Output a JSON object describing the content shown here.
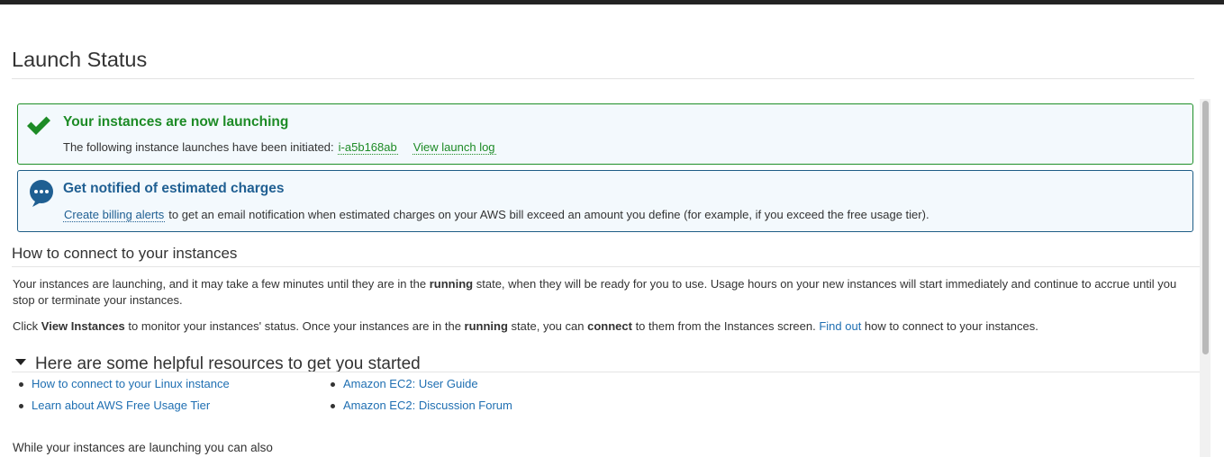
{
  "page": {
    "title": "Launch Status"
  },
  "success_alert": {
    "title": "Your instances are now launching",
    "text": "The following instance launches have been initiated:",
    "instance_id": "i-a5b168ab",
    "view_log": "View launch log"
  },
  "info_alert": {
    "title": "Get notified of estimated charges",
    "link": "Create billing alerts",
    "text": "to get an email notification when estimated charges on your AWS bill exceed an amount you define (for example, if you exceed the free usage tier)."
  },
  "connect": {
    "heading": "How to connect to your instances",
    "para1": {
      "t1": "Your instances are launching, and it may take a few minutes until they are in the ",
      "b1": "running",
      "t2": " state, when they will be ready for you to use. Usage hours on your new instances will start immediately and continue to accrue until you stop or terminate your instances."
    },
    "para2": {
      "t1": "Click ",
      "b1": "View Instances",
      "t2": " to monitor your instances' status. Once your instances are in the ",
      "b2": "running",
      "t3": " state, you can ",
      "b3": "connect",
      "t4": " to them from the Instances screen. ",
      "link": "Find out",
      "t5": " how to connect to your instances."
    }
  },
  "resources": {
    "heading": "Here are some helpful resources to get you started",
    "col1": [
      "How to connect to your Linux instance",
      "Learn about AWS Free Usage Tier"
    ],
    "col2": [
      "Amazon EC2: User Guide",
      "Amazon EC2: Discussion Forum"
    ]
  },
  "while_text": "While your instances are launching you can also",
  "colors": {
    "success": "#1d8b26",
    "info": "#1f5f92",
    "link": "#1f6fb2"
  },
  "icons": {
    "success": "checkmark-icon",
    "info": "chat-bubble-icon",
    "expand": "caret-down-icon"
  }
}
